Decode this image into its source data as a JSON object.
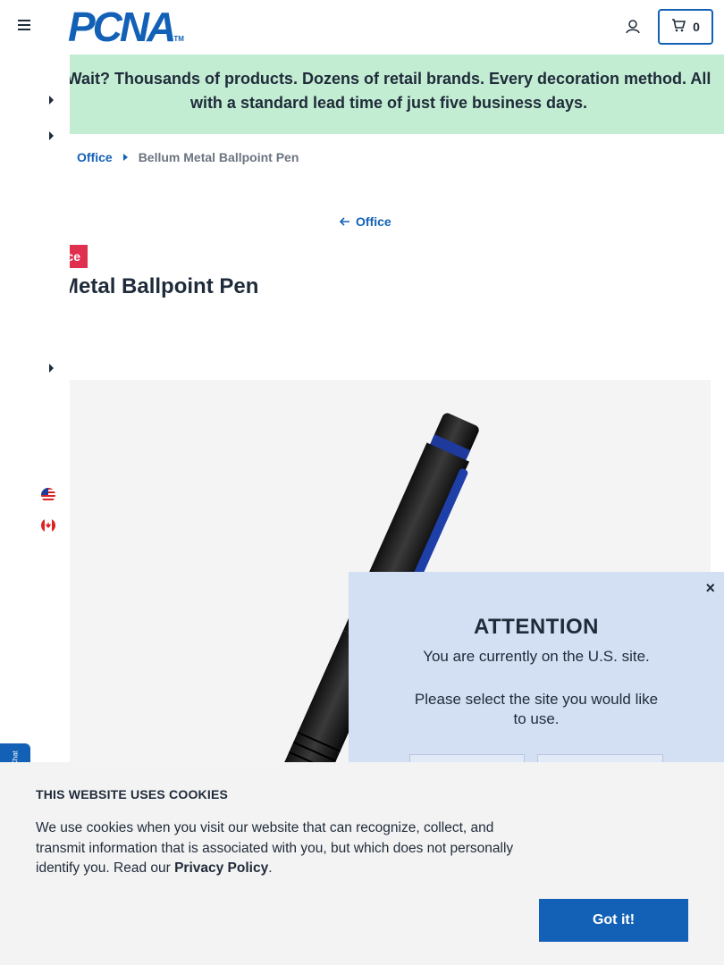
{
  "header": {
    "logo_text": "PCNA",
    "logo_tm": "TM",
    "cart_count": "0"
  },
  "promo": {
    "text": "Wait? Thousands of products. Dozens of retail brands. Every decoration method. All with a standard lead time of just five business days."
  },
  "breadcrumb": {
    "items": [
      "Office"
    ],
    "current": "Bellum Metal Ballpoint Pen"
  },
  "back_link": "Office",
  "product": {
    "badge": "ce",
    "title": "m Metal Ballpoint Pen"
  },
  "chat_tab": "Chat",
  "attention_modal": {
    "close": "×",
    "title": "ATTENTION",
    "message": "You are currently on the U.S. site.",
    "prompt": "Please select the site you would like to use."
  },
  "cookie_banner": {
    "title": "THIS WEBSITE USES COOKIES",
    "body": "We use cookies when you visit our website that can recognize, collect, and transmit information that is associated with you, but which does not personally identify you. Read our ",
    "link": "Privacy Policy",
    "suffix": ".",
    "button": "Got it!"
  },
  "colors": {
    "brand_blue": "#1361b6",
    "promo_green": "#c3edd2",
    "badge_red": "#e0304f",
    "modal_blue": "#d3e0f3"
  }
}
